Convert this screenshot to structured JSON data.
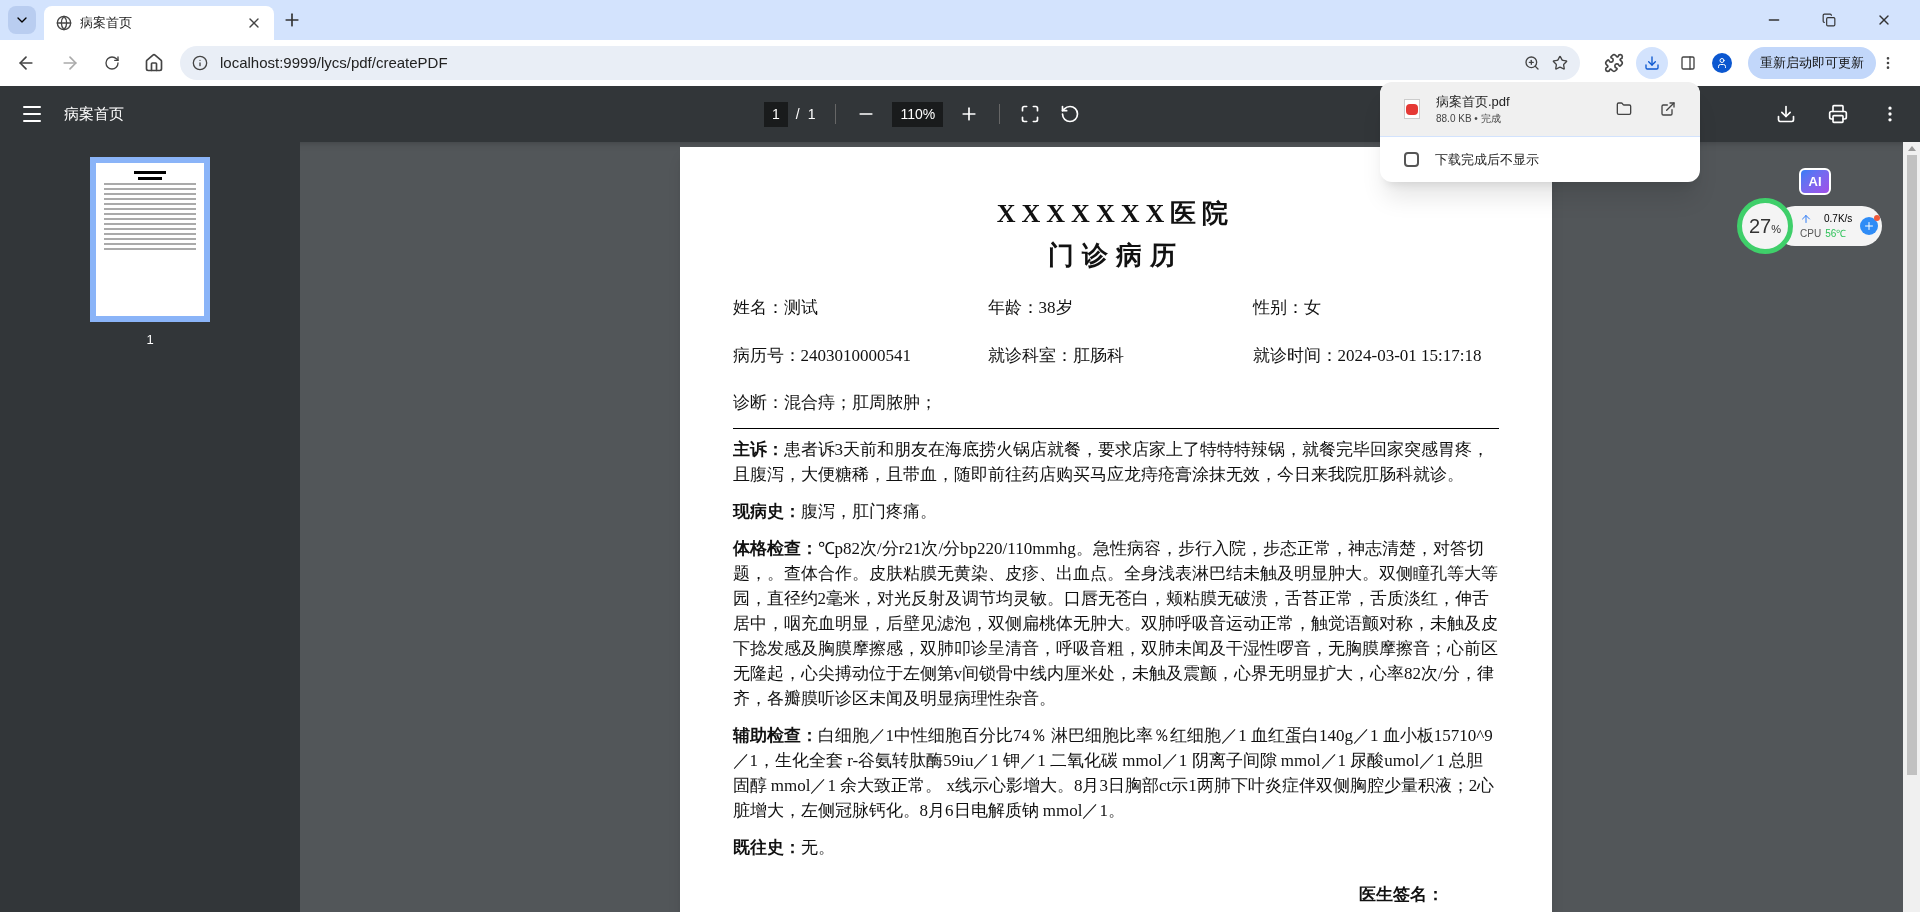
{
  "browser": {
    "tab_title": "病案首页",
    "url": "localhost:9999/lycs/pdf/createPDF",
    "update_button": "重新启动即可更新"
  },
  "pdf_toolbar": {
    "title": "病案首页",
    "page_current": "1",
    "page_separator": "/",
    "page_total": "1",
    "zoom": "110%"
  },
  "sidebar": {
    "thumbnails": [
      {
        "label": "1",
        "selected": true
      }
    ]
  },
  "download_popup": {
    "file_name": "病案首页.pdf",
    "file_meta": "88.0 KB • 完成",
    "option": {
      "label": "下载完成后不显示",
      "checked": false
    }
  },
  "document": {
    "title": "XXXXXXX医院",
    "subtitle": "门诊病历",
    "info_rows": [
      [
        "姓名：测试",
        "年龄：38岁",
        "性别：女"
      ],
      [
        "病历号：2403010000541",
        "就诊科室：肛肠科",
        "就诊时间：2024-03-01 15:17:18"
      ],
      [
        "诊断：混合痔；肛周脓肿；"
      ]
    ],
    "sections": [
      {
        "label": "主诉：",
        "text": "患者诉3天前和朋友在海底捞火锅店就餐，要求店家上了特特特辣锅，就餐完毕回家突感胃疼，且腹泻，大便糖稀，且带血，随即前往药店购买马应龙痔疮膏涂抹无效，今日来我院肛肠科就诊。"
      },
      {
        "label": "现病史：",
        "text": "腹泻，肛门疼痛。"
      },
      {
        "label": "体格检查：",
        "text": "℃p82次/分r21次/分bp220/110mmhg。急性病容，步行入院，步态正常，神志清楚，对答切题，。查体合作。皮肤粘膜无黄染、皮疹、出血点。全身浅表淋巴结未触及明显肿大。双侧瞳孔等大等园，直径约2毫米，对光反射及调节均灵敏。口唇无苍白，颊粘膜无破溃，舌苔正常，舌质淡红，伸舌居中，咽充血明显，后壁见滤泡，双侧扁桃体无肿大。双肺呼吸音运动正常，触觉语颤对称，未触及皮下捻发感及胸膜摩擦感，双肺叩诊呈清音，呼吸音粗，双肺未闻及干湿性啰音，无胸膜摩擦音；心前区无隆起，心尖搏动位于左侧第v间锁骨中线内厘米处，未触及震颤，心界无明显扩大，心率82次/分，律齐，各瓣膜听诊区未闻及明显病理性杂音。"
      },
      {
        "label": "辅助检查：",
        "text": "白细胞／1中性细胞百分比74％ 淋巴细胞比率％红细胞／1 血红蛋白140g／1 血小板15710^9／1，生化全套 r-谷氨转肽酶59iu／1 钾／1 二氧化碳 mmol／1 阴离子间隙 mmol／1 尿酸umol／1 总胆固醇 mmol／1 余大致正常。 x线示心影增大。8月3日胸部ct示1两肺下叶炎症伴双侧胸腔少量积液；2心脏增大，左侧冠脉钙化。8月6日电解质钠 mmol／1。"
      },
      {
        "label": "既往史：",
        "text": "无。"
      }
    ],
    "signature": "医生签名："
  },
  "widget": {
    "ai_badge": "AI",
    "cpu_percent": "27",
    "percent_sign": "%",
    "net_speed": "0.7K/s",
    "cpu_label": "CPU",
    "temperature": "56℃"
  }
}
